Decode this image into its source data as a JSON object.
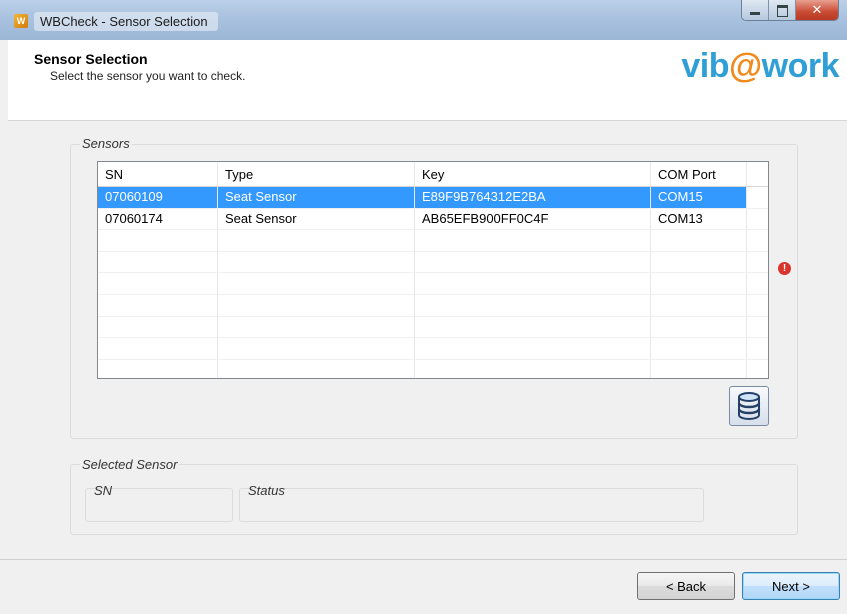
{
  "window": {
    "title": "WBCheck - Sensor Selection",
    "app_icon_label": "W"
  },
  "header": {
    "title": "Sensor Selection",
    "subtitle": "Select the sensor you want to check.",
    "logo_part1": "vib",
    "logo_part2": "@",
    "logo_part3": "work"
  },
  "sensors_group": {
    "legend": "Sensors",
    "columns": [
      "SN",
      "Type",
      "Key",
      "COM Port"
    ],
    "rows": [
      {
        "sn": "07060109",
        "type": "Seat Sensor",
        "key": "E89F9B764312E2BA",
        "com": "COM15",
        "selected": true
      },
      {
        "sn": "07060174",
        "type": "Seat Sensor",
        "key": "AB65EFB900FF0C4F",
        "com": "COM13",
        "selected": false
      }
    ],
    "empty_rows": 7
  },
  "selected_group": {
    "legend": "Selected Sensor",
    "sn_label": "SN",
    "status_label": "Status"
  },
  "buttons": {
    "back": "< Back",
    "next": "Next >"
  },
  "colors": {
    "selection": "#3399ff",
    "logo_blue": "#2f9fd6",
    "logo_orange": "#f08a1c",
    "error": "#d9342b"
  },
  "icons": {
    "error": "error-icon",
    "database": "database-icon",
    "close": "close-icon",
    "minimize": "minimize-icon",
    "maximize": "maximize-icon"
  }
}
